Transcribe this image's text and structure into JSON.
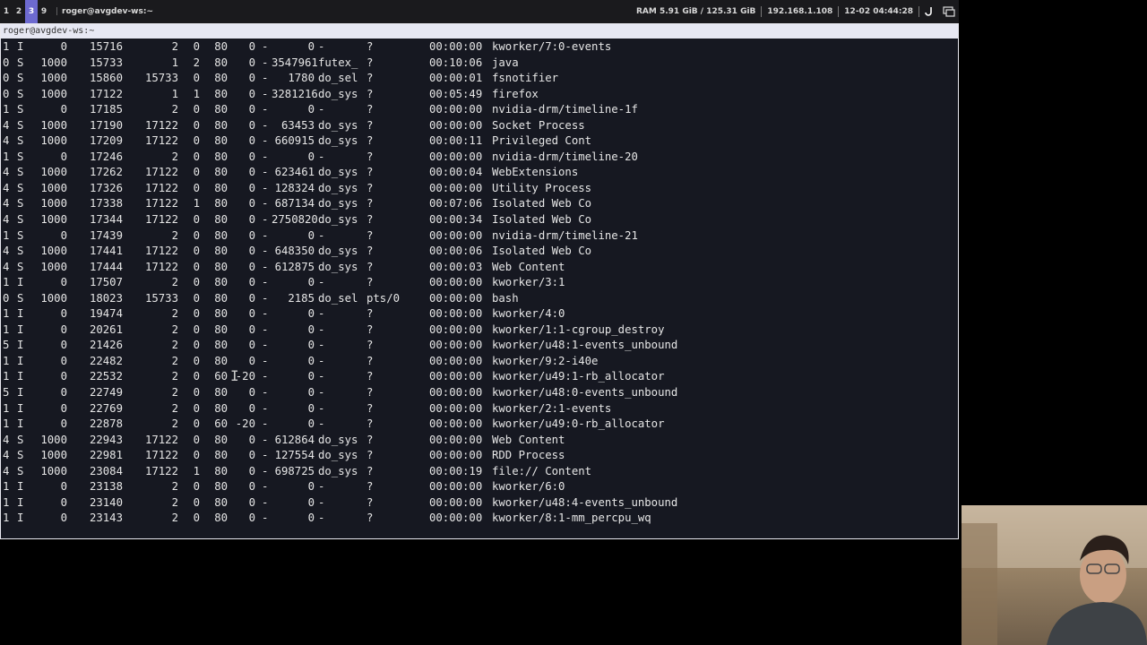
{
  "topbar": {
    "workspaces": [
      "1",
      "2",
      "3",
      "9"
    ],
    "active_workspace": "3",
    "window_title": "roger@avgdev-ws:~",
    "ram": "RAM 5.91 GiB / 125.31 GiB",
    "ip": "192.168.1.108",
    "datetime": "12-02 04:44:28",
    "icons": [
      "power-icon",
      "screen-icon"
    ]
  },
  "terminal": {
    "title": "roger@avgdev-ws:~",
    "rows": [
      {
        "f": "1",
        "s": "I",
        "uid": "0",
        "pid": "15716",
        "ppid": "2",
        "c": "0",
        "pri": "80",
        "ni": "0",
        "addr": "-",
        "sz": "0",
        "wchan": "-",
        "tty": "?",
        "time": "00:00:00",
        "cmd": "kworker/7:0-events"
      },
      {
        "f": "0",
        "s": "S",
        "uid": "1000",
        "pid": "15733",
        "ppid": "1",
        "c": "2",
        "pri": "80",
        "ni": "0",
        "addr": "-",
        "sz": "3547961",
        "wchan": "futex_",
        "tty": "?",
        "time": "00:10:06",
        "cmd": "java"
      },
      {
        "f": "0",
        "s": "S",
        "uid": "1000",
        "pid": "15860",
        "ppid": "15733",
        "c": "0",
        "pri": "80",
        "ni": "0",
        "addr": "-",
        "sz": "1780",
        "wchan": "do_sel",
        "tty": "?",
        "time": "00:00:01",
        "cmd": "fsnotifier"
      },
      {
        "f": "0",
        "s": "S",
        "uid": "1000",
        "pid": "17122",
        "ppid": "1",
        "c": "1",
        "pri": "80",
        "ni": "0",
        "addr": "-",
        "sz": "3281216",
        "wchan": "do_sys",
        "tty": "?",
        "time": "00:05:49",
        "cmd": "firefox"
      },
      {
        "f": "1",
        "s": "S",
        "uid": "0",
        "pid": "17185",
        "ppid": "2",
        "c": "0",
        "pri": "80",
        "ni": "0",
        "addr": "-",
        "sz": "0",
        "wchan": "-",
        "tty": "?",
        "time": "00:00:00",
        "cmd": "nvidia-drm/timeline-1f"
      },
      {
        "f": "4",
        "s": "S",
        "uid": "1000",
        "pid": "17190",
        "ppid": "17122",
        "c": "0",
        "pri": "80",
        "ni": "0",
        "addr": "-",
        "sz": "63453",
        "wchan": "do_sys",
        "tty": "?",
        "time": "00:00:00",
        "cmd": "Socket Process"
      },
      {
        "f": "4",
        "s": "S",
        "uid": "1000",
        "pid": "17209",
        "ppid": "17122",
        "c": "0",
        "pri": "80",
        "ni": "0",
        "addr": "-",
        "sz": "660915",
        "wchan": "do_sys",
        "tty": "?",
        "time": "00:00:11",
        "cmd": "Privileged Cont"
      },
      {
        "f": "1",
        "s": "S",
        "uid": "0",
        "pid": "17246",
        "ppid": "2",
        "c": "0",
        "pri": "80",
        "ni": "0",
        "addr": "-",
        "sz": "0",
        "wchan": "-",
        "tty": "?",
        "time": "00:00:00",
        "cmd": "nvidia-drm/timeline-20"
      },
      {
        "f": "4",
        "s": "S",
        "uid": "1000",
        "pid": "17262",
        "ppid": "17122",
        "c": "0",
        "pri": "80",
        "ni": "0",
        "addr": "-",
        "sz": "623461",
        "wchan": "do_sys",
        "tty": "?",
        "time": "00:00:04",
        "cmd": "WebExtensions"
      },
      {
        "f": "4",
        "s": "S",
        "uid": "1000",
        "pid": "17326",
        "ppid": "17122",
        "c": "0",
        "pri": "80",
        "ni": "0",
        "addr": "-",
        "sz": "128324",
        "wchan": "do_sys",
        "tty": "?",
        "time": "00:00:00",
        "cmd": "Utility Process"
      },
      {
        "f": "4",
        "s": "S",
        "uid": "1000",
        "pid": "17338",
        "ppid": "17122",
        "c": "1",
        "pri": "80",
        "ni": "0",
        "addr": "-",
        "sz": "687134",
        "wchan": "do_sys",
        "tty": "?",
        "time": "00:07:06",
        "cmd": "Isolated Web Co"
      },
      {
        "f": "4",
        "s": "S",
        "uid": "1000",
        "pid": "17344",
        "ppid": "17122",
        "c": "0",
        "pri": "80",
        "ni": "0",
        "addr": "-",
        "sz": "2750820",
        "wchan": "do_sys",
        "tty": "?",
        "time": "00:00:34",
        "cmd": "Isolated Web Co"
      },
      {
        "f": "1",
        "s": "S",
        "uid": "0",
        "pid": "17439",
        "ppid": "2",
        "c": "0",
        "pri": "80",
        "ni": "0",
        "addr": "-",
        "sz": "0",
        "wchan": "-",
        "tty": "?",
        "time": "00:00:00",
        "cmd": "nvidia-drm/timeline-21"
      },
      {
        "f": "4",
        "s": "S",
        "uid": "1000",
        "pid": "17441",
        "ppid": "17122",
        "c": "0",
        "pri": "80",
        "ni": "0",
        "addr": "-",
        "sz": "648350",
        "wchan": "do_sys",
        "tty": "?",
        "time": "00:00:06",
        "cmd": "Isolated Web Co"
      },
      {
        "f": "4",
        "s": "S",
        "uid": "1000",
        "pid": "17444",
        "ppid": "17122",
        "c": "0",
        "pri": "80",
        "ni": "0",
        "addr": "-",
        "sz": "612875",
        "wchan": "do_sys",
        "tty": "?",
        "time": "00:00:03",
        "cmd": "Web Content"
      },
      {
        "f": "1",
        "s": "I",
        "uid": "0",
        "pid": "17507",
        "ppid": "2",
        "c": "0",
        "pri": "80",
        "ni": "0",
        "addr": "-",
        "sz": "0",
        "wchan": "-",
        "tty": "?",
        "time": "00:00:00",
        "cmd": "kworker/3:1"
      },
      {
        "f": "0",
        "s": "S",
        "uid": "1000",
        "pid": "18023",
        "ppid": "15733",
        "c": "0",
        "pri": "80",
        "ni": "0",
        "addr": "-",
        "sz": "2185",
        "wchan": "do_sel",
        "tty": "pts/0",
        "time": "00:00:00",
        "cmd": "bash"
      },
      {
        "f": "1",
        "s": "I",
        "uid": "0",
        "pid": "19474",
        "ppid": "2",
        "c": "0",
        "pri": "80",
        "ni": "0",
        "addr": "-",
        "sz": "0",
        "wchan": "-",
        "tty": "?",
        "time": "00:00:00",
        "cmd": "kworker/4:0"
      },
      {
        "f": "1",
        "s": "I",
        "uid": "0",
        "pid": "20261",
        "ppid": "2",
        "c": "0",
        "pri": "80",
        "ni": "0",
        "addr": "-",
        "sz": "0",
        "wchan": "-",
        "tty": "?",
        "time": "00:00:00",
        "cmd": "kworker/1:1-cgroup_destroy"
      },
      {
        "f": "5",
        "s": "I",
        "uid": "0",
        "pid": "21426",
        "ppid": "2",
        "c": "0",
        "pri": "80",
        "ni": "0",
        "addr": "-",
        "sz": "0",
        "wchan": "-",
        "tty": "?",
        "time": "00:00:00",
        "cmd": "kworker/u48:1-events_unbound"
      },
      {
        "f": "1",
        "s": "I",
        "uid": "0",
        "pid": "22482",
        "ppid": "2",
        "c": "0",
        "pri": "80",
        "ni": "0",
        "addr": "-",
        "sz": "0",
        "wchan": "-",
        "tty": "?",
        "time": "00:00:00",
        "cmd": "kworker/9:2-i40e"
      },
      {
        "f": "1",
        "s": "I",
        "uid": "0",
        "pid": "22532",
        "ppid": "2",
        "c": "0",
        "pri": "60",
        "ni": "-20",
        "addr": "-",
        "sz": "0",
        "wchan": "-",
        "tty": "?",
        "time": "00:00:00",
        "cmd": "kworker/u49:1-rb_allocator"
      },
      {
        "f": "5",
        "s": "I",
        "uid": "0",
        "pid": "22749",
        "ppid": "2",
        "c": "0",
        "pri": "80",
        "ni": "0",
        "addr": "-",
        "sz": "0",
        "wchan": "-",
        "tty": "?",
        "time": "00:00:00",
        "cmd": "kworker/u48:0-events_unbound"
      },
      {
        "f": "1",
        "s": "I",
        "uid": "0",
        "pid": "22769",
        "ppid": "2",
        "c": "0",
        "pri": "80",
        "ni": "0",
        "addr": "-",
        "sz": "0",
        "wchan": "-",
        "tty": "?",
        "time": "00:00:00",
        "cmd": "kworker/2:1-events"
      },
      {
        "f": "1",
        "s": "I",
        "uid": "0",
        "pid": "22878",
        "ppid": "2",
        "c": "0",
        "pri": "60",
        "ni": "-20",
        "addr": "-",
        "sz": "0",
        "wchan": "-",
        "tty": "?",
        "time": "00:00:00",
        "cmd": "kworker/u49:0-rb_allocator"
      },
      {
        "f": "4",
        "s": "S",
        "uid": "1000",
        "pid": "22943",
        "ppid": "17122",
        "c": "0",
        "pri": "80",
        "ni": "0",
        "addr": "-",
        "sz": "612864",
        "wchan": "do_sys",
        "tty": "?",
        "time": "00:00:00",
        "cmd": "Web Content"
      },
      {
        "f": "4",
        "s": "S",
        "uid": "1000",
        "pid": "22981",
        "ppid": "17122",
        "c": "0",
        "pri": "80",
        "ni": "0",
        "addr": "-",
        "sz": "127554",
        "wchan": "do_sys",
        "tty": "?",
        "time": "00:00:00",
        "cmd": "RDD Process"
      },
      {
        "f": "4",
        "s": "S",
        "uid": "1000",
        "pid": "23084",
        "ppid": "17122",
        "c": "1",
        "pri": "80",
        "ni": "0",
        "addr": "-",
        "sz": "698725",
        "wchan": "do_sys",
        "tty": "?",
        "time": "00:00:19",
        "cmd": "file:// Content"
      },
      {
        "f": "1",
        "s": "I",
        "uid": "0",
        "pid": "23138",
        "ppid": "2",
        "c": "0",
        "pri": "80",
        "ni": "0",
        "addr": "-",
        "sz": "0",
        "wchan": "-",
        "tty": "?",
        "time": "00:00:00",
        "cmd": "kworker/6:0"
      },
      {
        "f": "1",
        "s": "I",
        "uid": "0",
        "pid": "23140",
        "ppid": "2",
        "c": "0",
        "pri": "80",
        "ni": "0",
        "addr": "-",
        "sz": "0",
        "wchan": "-",
        "tty": "?",
        "time": "00:00:00",
        "cmd": "kworker/u48:4-events_unbound"
      },
      {
        "f": "1",
        "s": "I",
        "uid": "0",
        "pid": "23143",
        "ppid": "2",
        "c": "0",
        "pri": "80",
        "ni": "0",
        "addr": "-",
        "sz": "0",
        "wchan": "-",
        "tty": "?",
        "time": "00:00:00",
        "cmd": "kworker/8:1-mm_percpu_wq"
      }
    ]
  },
  "colors": {
    "accent": "#6d6ad0",
    "terminal_bg": "#161821",
    "topbar_bg": "#1a1a1d",
    "title_bar": "#e7e8f3"
  }
}
